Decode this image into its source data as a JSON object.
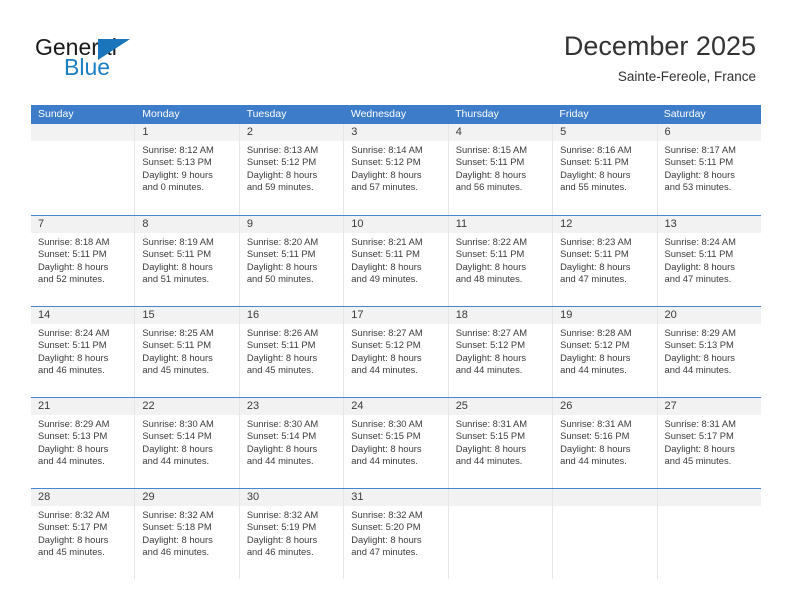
{
  "brand": {
    "name_top": "General",
    "name_bottom": "Blue",
    "triangle_color": "#1b75bb",
    "blue_color": "#1b7fc4"
  },
  "header": {
    "title": "December 2025",
    "subtitle": "Sainte-Fereole, France"
  },
  "theme": {
    "header_bar": "#3d7cc9",
    "day_band": "#f2f2f2",
    "row_divider": "#4a86cd",
    "column_divider": "#e6e6e6",
    "text": "#3b3b3b"
  },
  "weekdays": [
    "Sunday",
    "Monday",
    "Tuesday",
    "Wednesday",
    "Thursday",
    "Friday",
    "Saturday"
  ],
  "weeks": [
    [
      {
        "day": "",
        "empty": true
      },
      {
        "day": "1",
        "sunrise": "Sunrise: 8:12 AM",
        "sunset": "Sunset: 5:13 PM",
        "daylight1": "Daylight: 9 hours",
        "daylight2": "and 0 minutes."
      },
      {
        "day": "2",
        "sunrise": "Sunrise: 8:13 AM",
        "sunset": "Sunset: 5:12 PM",
        "daylight1": "Daylight: 8 hours",
        "daylight2": "and 59 minutes."
      },
      {
        "day": "3",
        "sunrise": "Sunrise: 8:14 AM",
        "sunset": "Sunset: 5:12 PM",
        "daylight1": "Daylight: 8 hours",
        "daylight2": "and 57 minutes."
      },
      {
        "day": "4",
        "sunrise": "Sunrise: 8:15 AM",
        "sunset": "Sunset: 5:11 PM",
        "daylight1": "Daylight: 8 hours",
        "daylight2": "and 56 minutes."
      },
      {
        "day": "5",
        "sunrise": "Sunrise: 8:16 AM",
        "sunset": "Sunset: 5:11 PM",
        "daylight1": "Daylight: 8 hours",
        "daylight2": "and 55 minutes."
      },
      {
        "day": "6",
        "sunrise": "Sunrise: 8:17 AM",
        "sunset": "Sunset: 5:11 PM",
        "daylight1": "Daylight: 8 hours",
        "daylight2": "and 53 minutes."
      }
    ],
    [
      {
        "day": "7",
        "sunrise": "Sunrise: 8:18 AM",
        "sunset": "Sunset: 5:11 PM",
        "daylight1": "Daylight: 8 hours",
        "daylight2": "and 52 minutes."
      },
      {
        "day": "8",
        "sunrise": "Sunrise: 8:19 AM",
        "sunset": "Sunset: 5:11 PM",
        "daylight1": "Daylight: 8 hours",
        "daylight2": "and 51 minutes."
      },
      {
        "day": "9",
        "sunrise": "Sunrise: 8:20 AM",
        "sunset": "Sunset: 5:11 PM",
        "daylight1": "Daylight: 8 hours",
        "daylight2": "and 50 minutes."
      },
      {
        "day": "10",
        "sunrise": "Sunrise: 8:21 AM",
        "sunset": "Sunset: 5:11 PM",
        "daylight1": "Daylight: 8 hours",
        "daylight2": "and 49 minutes."
      },
      {
        "day": "11",
        "sunrise": "Sunrise: 8:22 AM",
        "sunset": "Sunset: 5:11 PM",
        "daylight1": "Daylight: 8 hours",
        "daylight2": "and 48 minutes."
      },
      {
        "day": "12",
        "sunrise": "Sunrise: 8:23 AM",
        "sunset": "Sunset: 5:11 PM",
        "daylight1": "Daylight: 8 hours",
        "daylight2": "and 47 minutes."
      },
      {
        "day": "13",
        "sunrise": "Sunrise: 8:24 AM",
        "sunset": "Sunset: 5:11 PM",
        "daylight1": "Daylight: 8 hours",
        "daylight2": "and 47 minutes."
      }
    ],
    [
      {
        "day": "14",
        "sunrise": "Sunrise: 8:24 AM",
        "sunset": "Sunset: 5:11 PM",
        "daylight1": "Daylight: 8 hours",
        "daylight2": "and 46 minutes."
      },
      {
        "day": "15",
        "sunrise": "Sunrise: 8:25 AM",
        "sunset": "Sunset: 5:11 PM",
        "daylight1": "Daylight: 8 hours",
        "daylight2": "and 45 minutes."
      },
      {
        "day": "16",
        "sunrise": "Sunrise: 8:26 AM",
        "sunset": "Sunset: 5:11 PM",
        "daylight1": "Daylight: 8 hours",
        "daylight2": "and 45 minutes."
      },
      {
        "day": "17",
        "sunrise": "Sunrise: 8:27 AM",
        "sunset": "Sunset: 5:12 PM",
        "daylight1": "Daylight: 8 hours",
        "daylight2": "and 44 minutes."
      },
      {
        "day": "18",
        "sunrise": "Sunrise: 8:27 AM",
        "sunset": "Sunset: 5:12 PM",
        "daylight1": "Daylight: 8 hours",
        "daylight2": "and 44 minutes."
      },
      {
        "day": "19",
        "sunrise": "Sunrise: 8:28 AM",
        "sunset": "Sunset: 5:12 PM",
        "daylight1": "Daylight: 8 hours",
        "daylight2": "and 44 minutes."
      },
      {
        "day": "20",
        "sunrise": "Sunrise: 8:29 AM",
        "sunset": "Sunset: 5:13 PM",
        "daylight1": "Daylight: 8 hours",
        "daylight2": "and 44 minutes."
      }
    ],
    [
      {
        "day": "21",
        "sunrise": "Sunrise: 8:29 AM",
        "sunset": "Sunset: 5:13 PM",
        "daylight1": "Daylight: 8 hours",
        "daylight2": "and 44 minutes."
      },
      {
        "day": "22",
        "sunrise": "Sunrise: 8:30 AM",
        "sunset": "Sunset: 5:14 PM",
        "daylight1": "Daylight: 8 hours",
        "daylight2": "and 44 minutes."
      },
      {
        "day": "23",
        "sunrise": "Sunrise: 8:30 AM",
        "sunset": "Sunset: 5:14 PM",
        "daylight1": "Daylight: 8 hours",
        "daylight2": "and 44 minutes."
      },
      {
        "day": "24",
        "sunrise": "Sunrise: 8:30 AM",
        "sunset": "Sunset: 5:15 PM",
        "daylight1": "Daylight: 8 hours",
        "daylight2": "and 44 minutes."
      },
      {
        "day": "25",
        "sunrise": "Sunrise: 8:31 AM",
        "sunset": "Sunset: 5:15 PM",
        "daylight1": "Daylight: 8 hours",
        "daylight2": "and 44 minutes."
      },
      {
        "day": "26",
        "sunrise": "Sunrise: 8:31 AM",
        "sunset": "Sunset: 5:16 PM",
        "daylight1": "Daylight: 8 hours",
        "daylight2": "and 44 minutes."
      },
      {
        "day": "27",
        "sunrise": "Sunrise: 8:31 AM",
        "sunset": "Sunset: 5:17 PM",
        "daylight1": "Daylight: 8 hours",
        "daylight2": "and 45 minutes."
      }
    ],
    [
      {
        "day": "28",
        "sunrise": "Sunrise: 8:32 AM",
        "sunset": "Sunset: 5:17 PM",
        "daylight1": "Daylight: 8 hours",
        "daylight2": "and 45 minutes."
      },
      {
        "day": "29",
        "sunrise": "Sunrise: 8:32 AM",
        "sunset": "Sunset: 5:18 PM",
        "daylight1": "Daylight: 8 hours",
        "daylight2": "and 46 minutes."
      },
      {
        "day": "30",
        "sunrise": "Sunrise: 8:32 AM",
        "sunset": "Sunset: 5:19 PM",
        "daylight1": "Daylight: 8 hours",
        "daylight2": "and 46 minutes."
      },
      {
        "day": "31",
        "sunrise": "Sunrise: 8:32 AM",
        "sunset": "Sunset: 5:20 PM",
        "daylight1": "Daylight: 8 hours",
        "daylight2": "and 47 minutes."
      },
      {
        "day": "",
        "empty": true
      },
      {
        "day": "",
        "empty": true
      },
      {
        "day": "",
        "empty": true
      }
    ]
  ]
}
